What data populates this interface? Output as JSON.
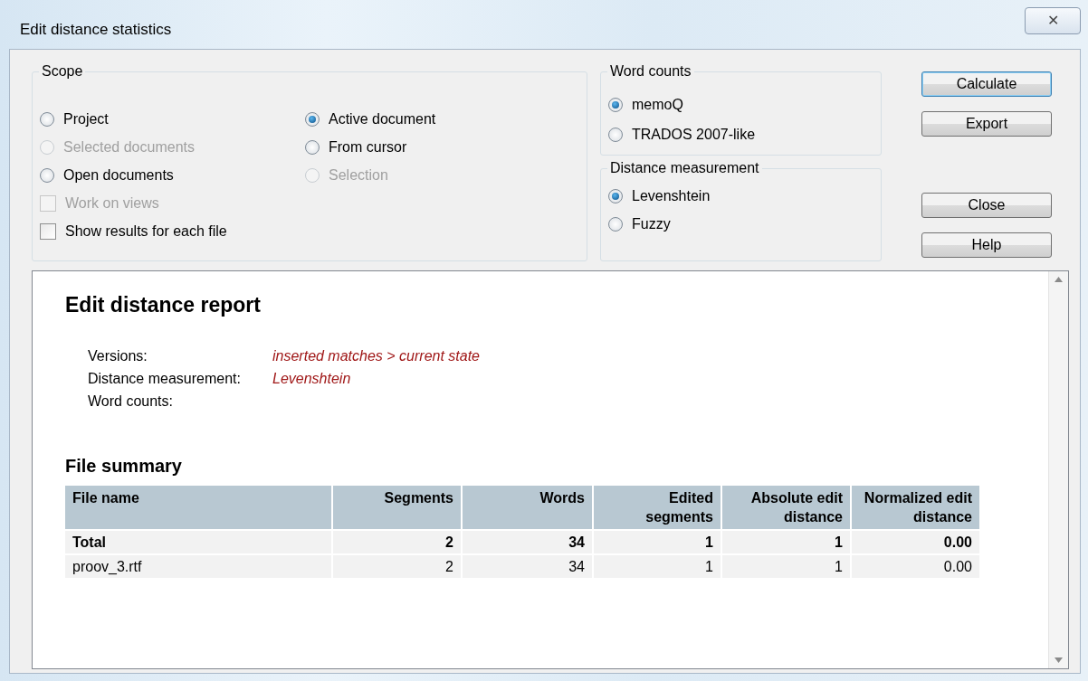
{
  "window": {
    "title": "Edit distance statistics",
    "close_label": "✕"
  },
  "scope": {
    "title": "Scope",
    "columns": [
      [
        {
          "kind": "radio",
          "label": "Project",
          "selected": false,
          "disabled": false
        },
        {
          "kind": "radio",
          "label": "Selected documents",
          "selected": false,
          "disabled": true
        },
        {
          "kind": "radio",
          "label": "Open documents",
          "selected": false,
          "disabled": false
        },
        {
          "kind": "checkbox",
          "label": "Work on views",
          "checked": false,
          "disabled": true
        },
        {
          "kind": "checkbox",
          "label": "Show results for each file",
          "checked": false,
          "disabled": false
        }
      ],
      [
        {
          "kind": "radio",
          "label": "Active document",
          "selected": true,
          "disabled": false
        },
        {
          "kind": "radio",
          "label": "From cursor",
          "selected": false,
          "disabled": false
        },
        {
          "kind": "radio",
          "label": "Selection",
          "selected": false,
          "disabled": true
        }
      ]
    ]
  },
  "word_counts": {
    "title": "Word counts",
    "options": [
      {
        "label": "memoQ",
        "selected": true
      },
      {
        "label": "TRADOS 2007-like",
        "selected": false
      }
    ]
  },
  "distance_measurement": {
    "title": "Distance measurement",
    "options": [
      {
        "label": "Levenshtein",
        "selected": true
      },
      {
        "label": "Fuzzy",
        "selected": false
      }
    ]
  },
  "buttons": [
    {
      "label": "Calculate",
      "default": true
    },
    {
      "label": "Export",
      "default": false
    },
    {
      "label": "Close",
      "default": false
    },
    {
      "label": "Help",
      "default": false
    }
  ],
  "report": {
    "title": "Edit distance report",
    "meta": [
      {
        "label": "Versions:",
        "value": "inserted matches > current state"
      },
      {
        "label": "Distance measurement:",
        "value": "Levenshtein"
      },
      {
        "label": "Word counts:"
      }
    ],
    "summary_title": "File summary",
    "table": {
      "columns": [
        "File name",
        "Segments",
        "Words",
        "Edited segments",
        "Absolute edit distance",
        "Normalized edit distance"
      ],
      "rows": [
        {
          "bold": true,
          "cells": [
            "Total",
            "2",
            "34",
            "1",
            "1",
            "0.00"
          ]
        },
        {
          "bold": false,
          "cells": [
            "proov_3.rtf",
            "2",
            "34",
            "1",
            "1",
            "0.00"
          ]
        }
      ]
    }
  }
}
